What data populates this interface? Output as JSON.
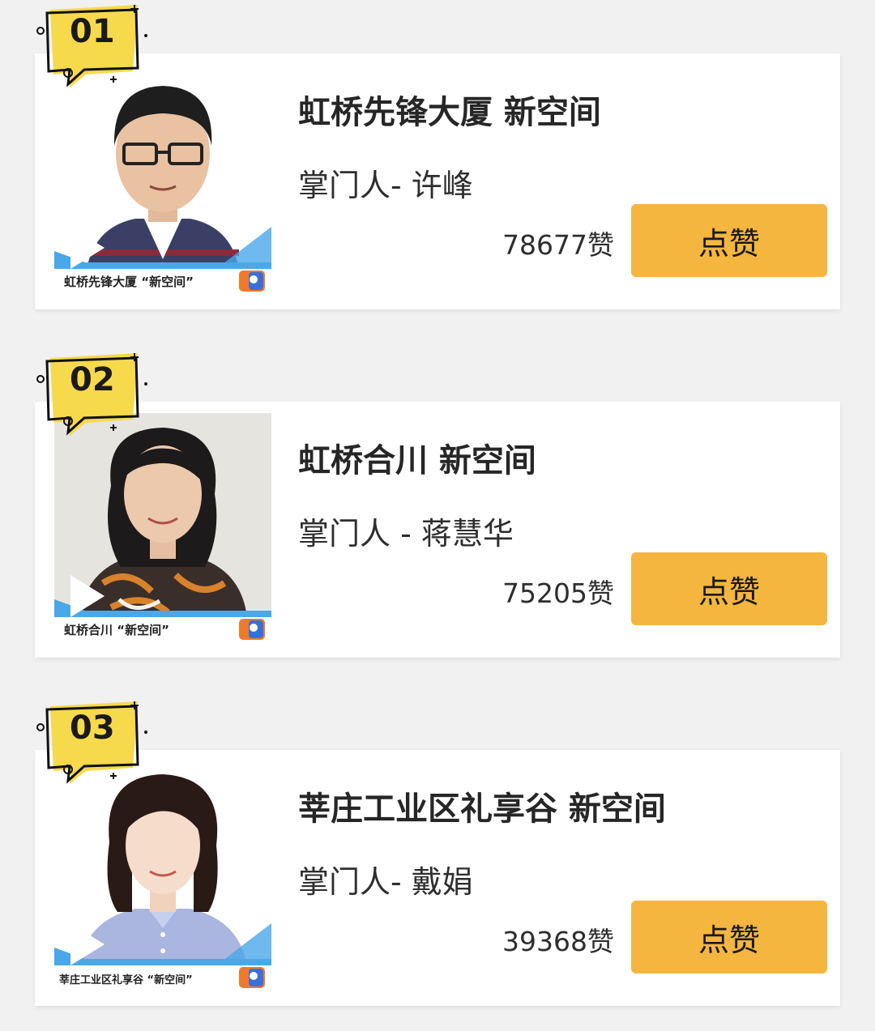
{
  "entries": [
    {
      "rank": "01",
      "title": "虹桥先锋大厦 新空间",
      "host": "掌门人- 许峰",
      "likes": "78677赞",
      "button_label": "点赞",
      "thumbnail_caption": "虹桥先锋大厦 “新空间”",
      "photo_bg": "#ffffff",
      "shirt_color": "#3b3f66"
    },
    {
      "rank": "02",
      "title": "虹桥合川 新空间",
      "host": "掌门人 - 蒋慧华",
      "likes": "75205赞",
      "button_label": "点赞",
      "thumbnail_caption": "虹桥合川 “新空间”",
      "photo_bg": "#e6e4df",
      "shirt_color": "#3a2e2a"
    },
    {
      "rank": "03",
      "title": "莘庄工业区礼享谷 新空间",
      "host": "掌门人- 戴娟",
      "likes": "39368赞",
      "button_label": "点赞",
      "thumbnail_caption": "莘庄工业区礼享谷 “新空间”",
      "photo_bg": "#ffffff",
      "shirt_color": "#aab6e0"
    }
  ],
  "colors": {
    "page_bg": "#f1f1f1",
    "button": "#f4b63f",
    "badge": "#f7d94c",
    "accent_blue": "#4aa8e8"
  }
}
